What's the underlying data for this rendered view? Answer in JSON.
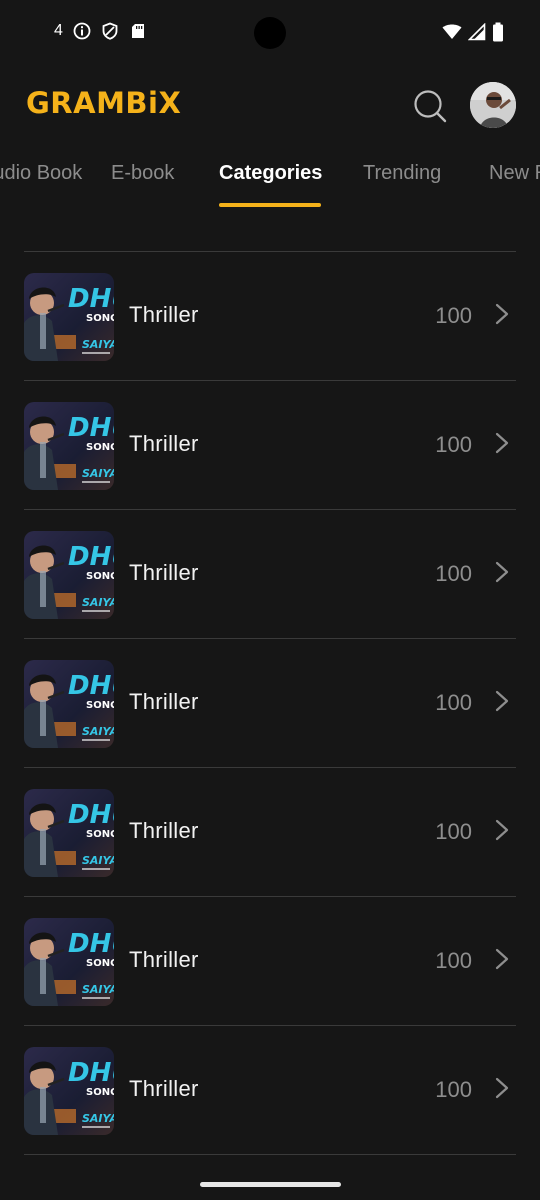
{
  "status_bar": {
    "notification_count": "4",
    "left_icons": [
      "info-icon",
      "shield-icon",
      "sd-card-icon"
    ],
    "right_icons": [
      "wifi-icon",
      "signal-icon",
      "battery-icon"
    ]
  },
  "header": {
    "logo": "GRAMBiX",
    "search_icon": "search-icon",
    "avatar_icon": "user-avatar"
  },
  "tabs": [
    {
      "label": "Audio Book",
      "active": false
    },
    {
      "label": "E-book",
      "active": false
    },
    {
      "label": "Categories",
      "active": true
    },
    {
      "label": "Trending",
      "active": false
    },
    {
      "label": "New Releases",
      "active": false
    }
  ],
  "categories": [
    {
      "thumb_title": "DHU",
      "thumb_subtitle": "SONG",
      "thumb_tag": "SAIYAARA",
      "label": "Thriller",
      "count": "100"
    },
    {
      "thumb_title": "DHU",
      "thumb_subtitle": "SONG",
      "thumb_tag": "SAIYAARA",
      "label": "Thriller",
      "count": "100"
    },
    {
      "thumb_title": "DHU",
      "thumb_subtitle": "SONG",
      "thumb_tag": "SAIYAARA",
      "label": "Thriller",
      "count": "100"
    },
    {
      "thumb_title": "DHU",
      "thumb_subtitle": "SONG",
      "thumb_tag": "SAIYAARA",
      "label": "Thriller",
      "count": "100"
    },
    {
      "thumb_title": "DHU",
      "thumb_subtitle": "SONG",
      "thumb_tag": "SAIYAARA",
      "label": "Thriller",
      "count": "100"
    },
    {
      "thumb_title": "DHU",
      "thumb_subtitle": "SONG",
      "thumb_tag": "SAIYAARA",
      "label": "Thriller",
      "count": "100"
    },
    {
      "thumb_title": "DHU",
      "thumb_subtitle": "SONG",
      "thumb_tag": "SAIYAARA",
      "label": "Thriller",
      "count": "100"
    }
  ],
  "colors": {
    "background": "#161616",
    "accent": "#f5b21a",
    "divider": "#3a3a3a",
    "muted_text": "#8e8e8e"
  }
}
